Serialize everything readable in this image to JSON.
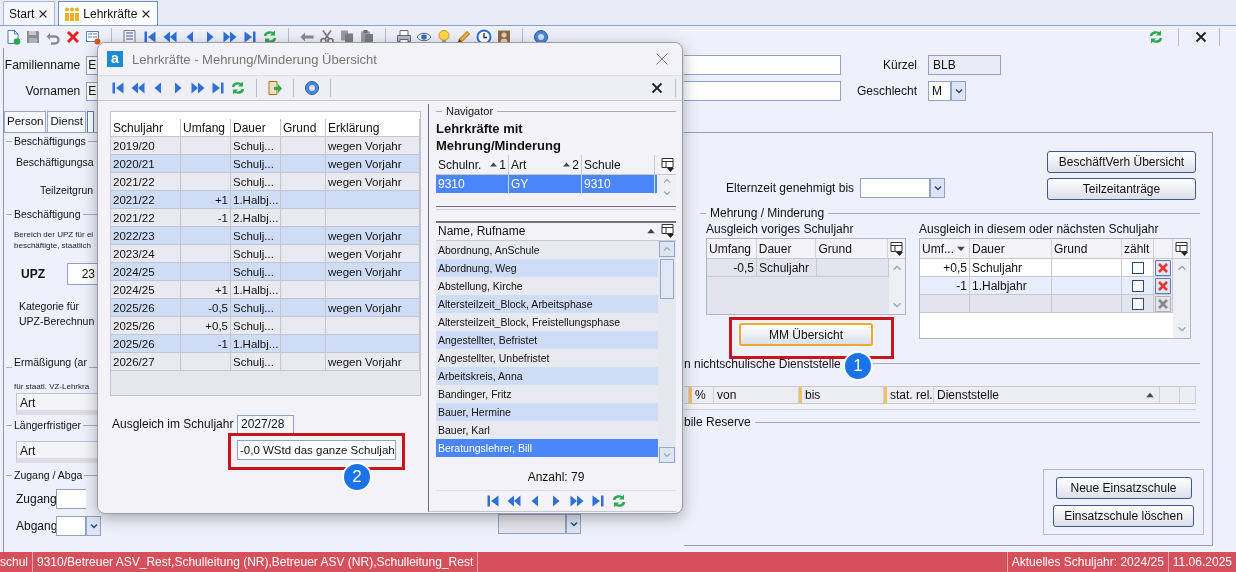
{
  "tabs": [
    {
      "label": "Start",
      "selected": false
    },
    {
      "label": "Lehrkräfte",
      "selected": true
    }
  ],
  "person": {
    "rows": [
      {
        "label": "Familienname",
        "value": "E"
      },
      {
        "label": "Vornamen",
        "value": "E"
      }
    ],
    "kuerzel": {
      "label": "Kürzel",
      "value": "BLB"
    },
    "geschlecht": {
      "label": "Geschlecht",
      "value": "M"
    }
  },
  "detail_tabs": [
    {
      "label": "Person",
      "selected": false
    },
    {
      "label": "Dienst",
      "selected": false
    },
    {
      "selected": true
    }
  ],
  "left_items": [
    {
      "kind": "group",
      "text": "Beschäftigungs"
    },
    {
      "kind": "label",
      "text": "Beschäftigungsa"
    },
    {
      "kind": "indent",
      "text": "Teilzeitgrun"
    },
    {
      "kind": "group",
      "text": "Beschäftigung"
    },
    {
      "kind": "note",
      "text": "Bereich der UPZ für ei"
    },
    {
      "kind": "note",
      "text": "beschäftigte, staatlich"
    },
    {
      "kind": "field",
      "text": "UPZ",
      "value": "23"
    },
    {
      "kind": "label",
      "text": "Kategorie für"
    },
    {
      "kind": "label",
      "text": "UPZ-Berechnun"
    },
    {
      "kind": "group",
      "text": "Ermäßigung (ar"
    },
    {
      "kind": "note",
      "text": "für staatl. VZ-Lehrkra"
    },
    {
      "kind": "header",
      "text": "Art"
    },
    {
      "kind": "group",
      "text": "Längerfristiger"
    },
    {
      "kind": "header",
      "text": "Art"
    },
    {
      "kind": "group",
      "text": "Zugang / Abga"
    },
    {
      "kind": "input",
      "text": "Zugang"
    },
    {
      "kind": "select",
      "text": "Abgang"
    }
  ],
  "employment": {
    "elternzeit_label": "Elternzeit genehmigt bis",
    "buttons": [
      {
        "label": "BeschäftVerh Übersicht",
        "focused": false
      },
      {
        "label": "Teilzeitanträge",
        "focused": false
      }
    ]
  },
  "mehrung": {
    "title": "Mehrung / Minderung",
    "previous": {
      "caption": "Ausgleich voriges Schuljahr",
      "columns": [
        "Umfang",
        "Dauer",
        "Grund"
      ],
      "rows": [
        {
          "umfang": "-0,5",
          "dauer": "Schuljahr"
        }
      ]
    },
    "current": {
      "caption": "Ausgleich in diesem oder nächsten Schuljahr",
      "columns": [
        "Umf...",
        "Dauer",
        "Grund",
        "zählt"
      ],
      "rows": [
        {
          "kind": "entry",
          "umfang": "+0,5",
          "dauer": "Schuljahr",
          "checked": false,
          "selected": false
        },
        {
          "kind": "entry",
          "umfang": "-1",
          "dauer": "1.Halbjahr",
          "checked": false,
          "selected": true
        },
        {
          "kind": "empty",
          "checked": false,
          "selected": false
        }
      ]
    },
    "button": {
      "label": "MM Übersicht",
      "focused": true
    },
    "callout": "1"
  },
  "dienststelle": {
    "title": "n nichtschulische Dienststelle",
    "columns": [
      "%",
      "von",
      "bis",
      "stat. rel.",
      "Dienststelle"
    ]
  },
  "reserve": {
    "title": "bile Reserve"
  },
  "einsatz_buttons": [
    {
      "label": "Neue Einsatzschule",
      "focused": false
    },
    {
      "label": "Einsatzschule löschen",
      "focused": false
    }
  ],
  "dialog": {
    "logo": "a",
    "title": "Lehrkräfte - Mehrung/Minderung Übersicht",
    "table": {
      "columns": [
        "Schuljahr",
        "Umfang",
        "Dauer",
        "Grund",
        "Erklärung"
      ],
      "rows": [
        {
          "schuljahr": "2019/20",
          "dauer": "Schulj...",
          "erklaerung": "wegen Vorjahr"
        },
        {
          "schuljahr": "2020/21",
          "dauer": "Schulj...",
          "erklaerung": "wegen Vorjahr"
        },
        {
          "schuljahr": "2021/22",
          "dauer": "Schulj...",
          "erklaerung": "wegen Vorjahr"
        },
        {
          "schuljahr": "2021/22",
          "umfang": "+1",
          "dauer": "1.Halbj..."
        },
        {
          "schuljahr": "2021/22",
          "umfang": "-1",
          "dauer": "2.Halbj..."
        },
        {
          "schuljahr": "2022/23",
          "dauer": "Schulj...",
          "erklaerung": "wegen Vorjahr"
        },
        {
          "schuljahr": "2023/24",
          "dauer": "Schulj...",
          "erklaerung": "wegen Vorjahr"
        },
        {
          "schuljahr": "2024/25",
          "dauer": "Schulj...",
          "erklaerung": "wegen Vorjahr"
        },
        {
          "schuljahr": "2024/25",
          "umfang": "+1",
          "dauer": "1.Halbj..."
        },
        {
          "schuljahr": "2025/26",
          "umfang": "-0,5",
          "dauer": "Schulj...",
          "erklaerung": "wegen Vorjahr"
        },
        {
          "schuljahr": "2025/26",
          "umfang": "+0,5",
          "dauer": "Schulj..."
        },
        {
          "schuljahr": "2025/26",
          "umfang": "-1",
          "dauer": "1.Halbj..."
        },
        {
          "schuljahr": "2026/27",
          "dauer": "Schulj...",
          "erklaerung": "wegen Vorjahr"
        }
      ]
    },
    "ausgleich": {
      "label": "Ausgleich im Schuljahr",
      "value": "2027/28",
      "summary": "-0,0 WStd das ganze Schuljah",
      "callout": "2"
    },
    "navigator": {
      "legend": "Navigator",
      "title": "Lehrkräfte mit Mehrung/Minderung",
      "schools": {
        "columns": [
          {
            "label": "Schulnr.",
            "sort": "1"
          },
          {
            "label": "Art",
            "sort": "2"
          },
          {
            "label": "Schule"
          }
        ],
        "rows": [
          {
            "cells": [
              "9310",
              "GY",
              "9310"
            ],
            "selected": true
          }
        ]
      },
      "list": {
        "header": "Name, Rufname",
        "items": [
          {
            "name": "Abordnung, AnSchule",
            "selected": false
          },
          {
            "name": "Abordnung, Weg",
            "selected": false
          },
          {
            "name": "Abstellung, Kirche",
            "selected": false
          },
          {
            "name": "Altersteilzeit_Block, Arbeitsphase",
            "selected": false
          },
          {
            "name": "Altersteilzeit_Block, Freistellungsphase",
            "selected": false
          },
          {
            "name": "Angestellter, Befristet",
            "selected": false
          },
          {
            "name": "Angestellter, Unbefristet",
            "selected": false
          },
          {
            "name": "Arbeitskreis, Anna",
            "selected": false
          },
          {
            "name": "Bandinger, Fritz",
            "selected": false
          },
          {
            "name": "Bauer, Hermine",
            "selected": false
          },
          {
            "name": "Bauer, Karl",
            "selected": false
          },
          {
            "name": "Beratungslehrer, Bill",
            "selected": true
          }
        ],
        "count": "Anzahl: 79"
      }
    }
  },
  "status_bar": [
    "schul",
    "9310/Betreuer ASV_Rest,Schulleitung (NR),Betreuer ASV (NR),Schulleitung_Rest",
    "Aktuelles Schuljahr: 2024/25",
    "11.06.2025"
  ]
}
